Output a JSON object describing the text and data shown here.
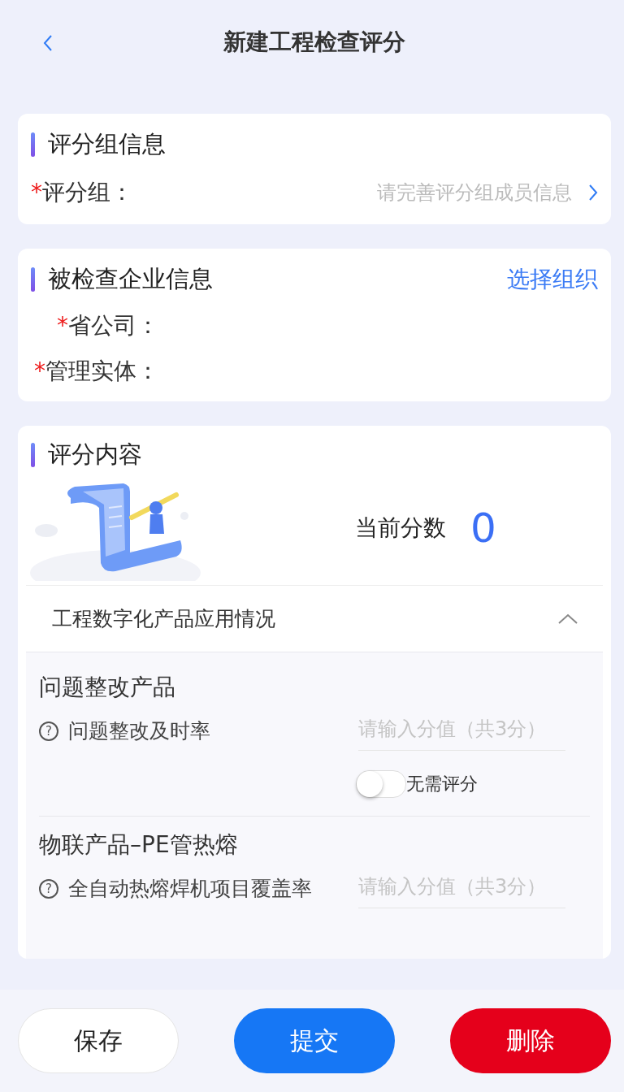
{
  "header": {
    "title": "新建工程检查评分"
  },
  "group_section": {
    "title": "评分组信息",
    "field": {
      "mark": "*",
      "label": "评分组：",
      "placeholder": "请完善评分组成员信息"
    }
  },
  "company_section": {
    "title": "被检查企业信息",
    "action": "选择组织",
    "fields": [
      {
        "mark": "*",
        "label": "省公司："
      },
      {
        "mark": "*",
        "label": "管理实体："
      }
    ]
  },
  "score_section": {
    "title": "评分内容",
    "score_label": "当前分数",
    "score": "0",
    "category": {
      "title": "工程数字化产品应用情况",
      "expanded": true,
      "items": [
        {
          "title": "问题整改产品",
          "help": "?",
          "criterion": "问题整改及时率",
          "placeholder": "请输入分值（共3分）",
          "toggle": {
            "on": false,
            "label": "无需评分"
          }
        },
        {
          "title": "物联产品–PE管热熔",
          "help": "?",
          "criterion": "全自动热熔焊机项目覆盖率",
          "placeholder": "请输入分值（共3分）"
        }
      ]
    }
  },
  "buttons": [
    {
      "label": "保存",
      "kind": "plain"
    },
    {
      "label": "提交",
      "kind": "primary"
    },
    {
      "label": "删除",
      "kind": "danger"
    }
  ]
}
